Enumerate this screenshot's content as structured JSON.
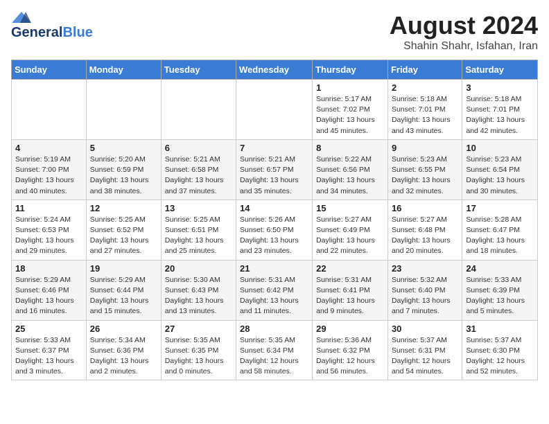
{
  "header": {
    "logo_line1": "General",
    "logo_line2": "Blue",
    "month_year": "August 2024",
    "location": "Shahin Shahr, Isfahan, Iran"
  },
  "days_of_week": [
    "Sunday",
    "Monday",
    "Tuesday",
    "Wednesday",
    "Thursday",
    "Friday",
    "Saturday"
  ],
  "weeks": [
    [
      {
        "day": "",
        "info": ""
      },
      {
        "day": "",
        "info": ""
      },
      {
        "day": "",
        "info": ""
      },
      {
        "day": "",
        "info": ""
      },
      {
        "day": "1",
        "info": "Sunrise: 5:17 AM\nSunset: 7:02 PM\nDaylight: 13 hours\nand 45 minutes."
      },
      {
        "day": "2",
        "info": "Sunrise: 5:18 AM\nSunset: 7:01 PM\nDaylight: 13 hours\nand 43 minutes."
      },
      {
        "day": "3",
        "info": "Sunrise: 5:18 AM\nSunset: 7:01 PM\nDaylight: 13 hours\nand 42 minutes."
      }
    ],
    [
      {
        "day": "4",
        "info": "Sunrise: 5:19 AM\nSunset: 7:00 PM\nDaylight: 13 hours\nand 40 minutes."
      },
      {
        "day": "5",
        "info": "Sunrise: 5:20 AM\nSunset: 6:59 PM\nDaylight: 13 hours\nand 38 minutes."
      },
      {
        "day": "6",
        "info": "Sunrise: 5:21 AM\nSunset: 6:58 PM\nDaylight: 13 hours\nand 37 minutes."
      },
      {
        "day": "7",
        "info": "Sunrise: 5:21 AM\nSunset: 6:57 PM\nDaylight: 13 hours\nand 35 minutes."
      },
      {
        "day": "8",
        "info": "Sunrise: 5:22 AM\nSunset: 6:56 PM\nDaylight: 13 hours\nand 34 minutes."
      },
      {
        "day": "9",
        "info": "Sunrise: 5:23 AM\nSunset: 6:55 PM\nDaylight: 13 hours\nand 32 minutes."
      },
      {
        "day": "10",
        "info": "Sunrise: 5:23 AM\nSunset: 6:54 PM\nDaylight: 13 hours\nand 30 minutes."
      }
    ],
    [
      {
        "day": "11",
        "info": "Sunrise: 5:24 AM\nSunset: 6:53 PM\nDaylight: 13 hours\nand 29 minutes."
      },
      {
        "day": "12",
        "info": "Sunrise: 5:25 AM\nSunset: 6:52 PM\nDaylight: 13 hours\nand 27 minutes."
      },
      {
        "day": "13",
        "info": "Sunrise: 5:25 AM\nSunset: 6:51 PM\nDaylight: 13 hours\nand 25 minutes."
      },
      {
        "day": "14",
        "info": "Sunrise: 5:26 AM\nSunset: 6:50 PM\nDaylight: 13 hours\nand 23 minutes."
      },
      {
        "day": "15",
        "info": "Sunrise: 5:27 AM\nSunset: 6:49 PM\nDaylight: 13 hours\nand 22 minutes."
      },
      {
        "day": "16",
        "info": "Sunrise: 5:27 AM\nSunset: 6:48 PM\nDaylight: 13 hours\nand 20 minutes."
      },
      {
        "day": "17",
        "info": "Sunrise: 5:28 AM\nSunset: 6:47 PM\nDaylight: 13 hours\nand 18 minutes."
      }
    ],
    [
      {
        "day": "18",
        "info": "Sunrise: 5:29 AM\nSunset: 6:46 PM\nDaylight: 13 hours\nand 16 minutes."
      },
      {
        "day": "19",
        "info": "Sunrise: 5:29 AM\nSunset: 6:44 PM\nDaylight: 13 hours\nand 15 minutes."
      },
      {
        "day": "20",
        "info": "Sunrise: 5:30 AM\nSunset: 6:43 PM\nDaylight: 13 hours\nand 13 minutes."
      },
      {
        "day": "21",
        "info": "Sunrise: 5:31 AM\nSunset: 6:42 PM\nDaylight: 13 hours\nand 11 minutes."
      },
      {
        "day": "22",
        "info": "Sunrise: 5:31 AM\nSunset: 6:41 PM\nDaylight: 13 hours\nand 9 minutes."
      },
      {
        "day": "23",
        "info": "Sunrise: 5:32 AM\nSunset: 6:40 PM\nDaylight: 13 hours\nand 7 minutes."
      },
      {
        "day": "24",
        "info": "Sunrise: 5:33 AM\nSunset: 6:39 PM\nDaylight: 13 hours\nand 5 minutes."
      }
    ],
    [
      {
        "day": "25",
        "info": "Sunrise: 5:33 AM\nSunset: 6:37 PM\nDaylight: 13 hours\nand 3 minutes."
      },
      {
        "day": "26",
        "info": "Sunrise: 5:34 AM\nSunset: 6:36 PM\nDaylight: 13 hours\nand 2 minutes."
      },
      {
        "day": "27",
        "info": "Sunrise: 5:35 AM\nSunset: 6:35 PM\nDaylight: 13 hours\nand 0 minutes."
      },
      {
        "day": "28",
        "info": "Sunrise: 5:35 AM\nSunset: 6:34 PM\nDaylight: 12 hours\nand 58 minutes."
      },
      {
        "day": "29",
        "info": "Sunrise: 5:36 AM\nSunset: 6:32 PM\nDaylight: 12 hours\nand 56 minutes."
      },
      {
        "day": "30",
        "info": "Sunrise: 5:37 AM\nSunset: 6:31 PM\nDaylight: 12 hours\nand 54 minutes."
      },
      {
        "day": "31",
        "info": "Sunrise: 5:37 AM\nSunset: 6:30 PM\nDaylight: 12 hours\nand 52 minutes."
      }
    ]
  ]
}
